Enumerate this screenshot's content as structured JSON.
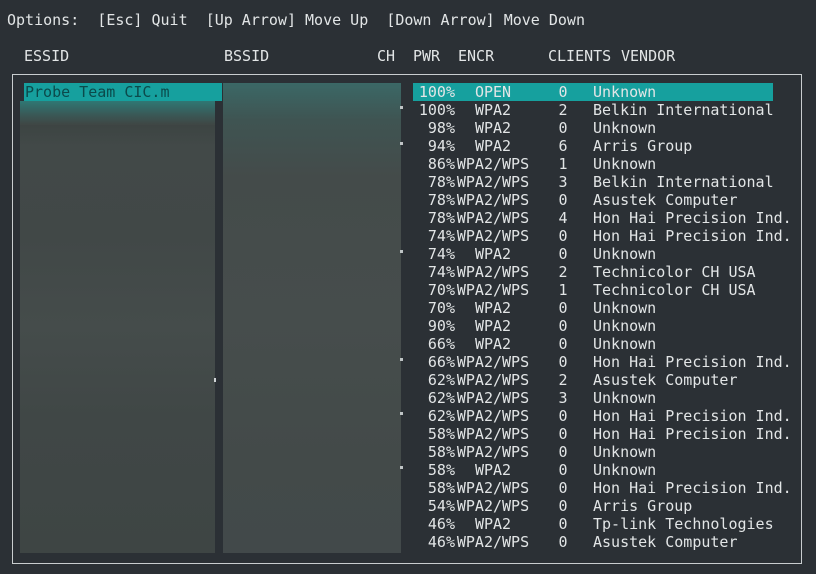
{
  "options": {
    "prefix": "Options:",
    "quit": "[Esc] Quit",
    "up": "[Up Arrow] Move Up",
    "down": "[Down Arrow] Move Down"
  },
  "columns": {
    "essid": "ESSID",
    "bssid": "BSSID",
    "ch": "CH",
    "pwr": "PWR",
    "encr": "ENCR",
    "clients": "CLIENTS",
    "vendor": "VENDOR"
  },
  "selected_essid": "Probe Team CIC.m",
  "networks": [
    {
      "pwr": "100%",
      "encr": "OPEN",
      "clients": "0",
      "vendor": "Unknown",
      "dot": false
    },
    {
      "pwr": "100%",
      "encr": "WPA2",
      "clients": "2",
      "vendor": "Belkin International",
      "dot": true
    },
    {
      "pwr": "98%",
      "encr": "WPA2",
      "clients": "0",
      "vendor": "Unknown",
      "dot": false
    },
    {
      "pwr": "94%",
      "encr": "WPA2",
      "clients": "6",
      "vendor": "Arris Group",
      "dot": true
    },
    {
      "pwr": "86%",
      "encr": "WPA2/WPS",
      "clients": "1",
      "vendor": "Unknown",
      "dot": false
    },
    {
      "pwr": "78%",
      "encr": "WPA2/WPS",
      "clients": "3",
      "vendor": "Belkin International",
      "dot": false
    },
    {
      "pwr": "78%",
      "encr": "WPA2/WPS",
      "clients": "0",
      "vendor": "Asustek Computer",
      "dot": false
    },
    {
      "pwr": "78%",
      "encr": "WPA2/WPS",
      "clients": "4",
      "vendor": "Hon Hai Precision Ind.",
      "dot": false
    },
    {
      "pwr": "74%",
      "encr": "WPA2/WPS",
      "clients": "0",
      "vendor": "Hon Hai Precision Ind.",
      "dot": false
    },
    {
      "pwr": "74%",
      "encr": "WPA2",
      "clients": "0",
      "vendor": "Unknown",
      "dot": true
    },
    {
      "pwr": "74%",
      "encr": "WPA2/WPS",
      "clients": "2",
      "vendor": "Technicolor CH USA",
      "dot": false
    },
    {
      "pwr": "70%",
      "encr": "WPA2/WPS",
      "clients": "1",
      "vendor": "Technicolor CH USA",
      "dot": false
    },
    {
      "pwr": "70%",
      "encr": "WPA2",
      "clients": "0",
      "vendor": "Unknown",
      "dot": false
    },
    {
      "pwr": "90%",
      "encr": "WPA2",
      "clients": "0",
      "vendor": "Unknown",
      "dot": false
    },
    {
      "pwr": "66%",
      "encr": "WPA2",
      "clients": "0",
      "vendor": "Unknown",
      "dot": false
    },
    {
      "pwr": "66%",
      "encr": "WPA2/WPS",
      "clients": "0",
      "vendor": "Hon Hai Precision Ind.",
      "dot": true
    },
    {
      "pwr": "62%",
      "encr": "WPA2/WPS",
      "clients": "2",
      "vendor": "Asustek Computer",
      "dot": false
    },
    {
      "pwr": "62%",
      "encr": "WPA2/WPS",
      "clients": "3",
      "vendor": "Unknown",
      "dot": false
    },
    {
      "pwr": "62%",
      "encr": "WPA2/WPS",
      "clients": "0",
      "vendor": "Hon Hai Precision Ind.",
      "dot": true
    },
    {
      "pwr": "58%",
      "encr": "WPA2/WPS",
      "clients": "0",
      "vendor": "Hon Hai Precision Ind.",
      "dot": false
    },
    {
      "pwr": "58%",
      "encr": "WPA2/WPS",
      "clients": "0",
      "vendor": "Unknown",
      "dot": false
    },
    {
      "pwr": "58%",
      "encr": "WPA2",
      "clients": "0",
      "vendor": "Unknown",
      "dot": true
    },
    {
      "pwr": "58%",
      "encr": "WPA2/WPS",
      "clients": "0",
      "vendor": "Hon Hai Precision Ind.",
      "dot": false
    },
    {
      "pwr": "54%",
      "encr": "WPA2/WPS",
      "clients": "0",
      "vendor": "Arris Group",
      "dot": false
    },
    {
      "pwr": "46%",
      "encr": "WPA2",
      "clients": "0",
      "vendor": "Tp-link Technologies",
      "dot": false
    },
    {
      "pwr": "46%",
      "encr": "WPA2/WPS",
      "clients": "0",
      "vendor": "Asustek Computer",
      "dot": false
    }
  ]
}
